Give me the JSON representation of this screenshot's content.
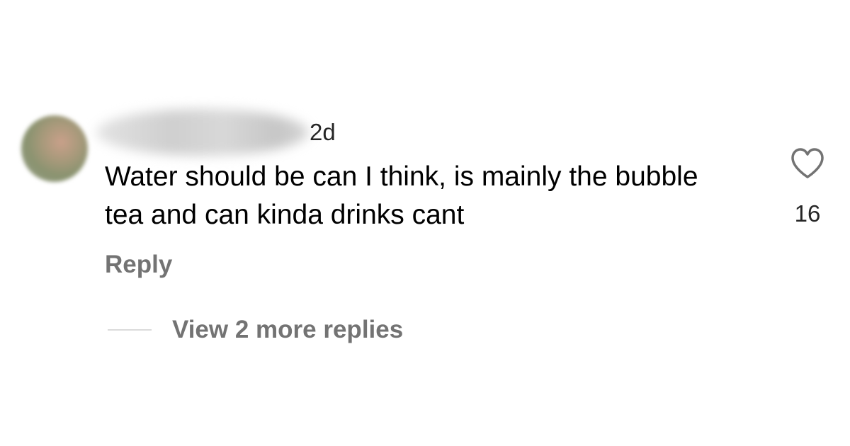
{
  "comment": {
    "timestamp": "2d",
    "text": "Water should be can I think, is mainly the bubble tea and can kinda drinks cant",
    "reply_label": "Reply",
    "like_count": "16",
    "like_icon": "heart-outline-icon"
  },
  "replies": {
    "view_more_label": "View 2 more replies"
  },
  "colors": {
    "text_primary": "#000000",
    "text_secondary": "#737373",
    "divider": "#dbdbdb"
  }
}
